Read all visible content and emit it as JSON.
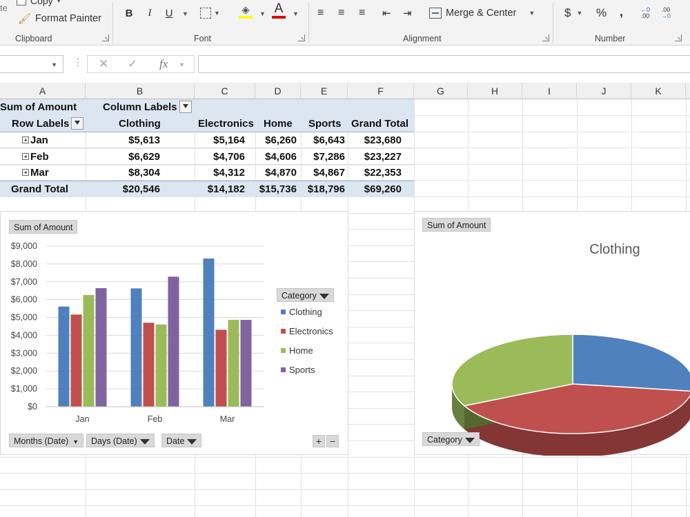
{
  "ribbon": {
    "clipboard": {
      "copy_label": "Copy",
      "format_painter_label": "Format Painter",
      "group_label": "Clipboard",
      "paste_partial": "te"
    },
    "font": {
      "group_label": "Font",
      "bold": "B",
      "italic": "I",
      "underline": "U",
      "font_color_glyph": "A"
    },
    "alignment": {
      "group_label": "Alignment",
      "merge_label": "Merge & Center"
    },
    "number": {
      "group_label": "Number",
      "currency": "$",
      "percent": "%",
      "comma": ",",
      "inc_decimal_top": ".00",
      "dec_decimal_top": ".00"
    }
  },
  "formula_bar": {
    "fx": "fx",
    "value": ""
  },
  "columns": [
    "A",
    "B",
    "C",
    "D",
    "E",
    "F",
    "G",
    "H",
    "I",
    "J",
    "K"
  ],
  "pivot": {
    "title": "Sum of Amount",
    "column_labels": "Column Labels",
    "row_labels": "Row Labels",
    "headers": [
      "Clothing",
      "Electronics",
      "Home",
      "Sports",
      "Grand Total"
    ],
    "rows": [
      {
        "label": "Jan",
        "values": [
          "$5,613",
          "$5,164",
          "$6,260",
          "$6,643",
          "$23,680"
        ]
      },
      {
        "label": "Feb",
        "values": [
          "$6,629",
          "$4,706",
          "$4,606",
          "$7,286",
          "$23,227"
        ]
      },
      {
        "label": "Mar",
        "values": [
          "$8,304",
          "$4,312",
          "$4,870",
          "$4,867",
          "$22,353"
        ]
      }
    ],
    "grand_total": {
      "label": "Grand Total",
      "values": [
        "$20,546",
        "$14,182",
        "$15,736",
        "$18,796",
        "$69,260"
      ]
    }
  },
  "bar_chart": {
    "value_button": "Sum of Amount",
    "legend_title": "Category",
    "axis_buttons": [
      "Months (Date)",
      "Days (Date)",
      "Date"
    ],
    "plus": "+",
    "minus": "−"
  },
  "pie_chart": {
    "value_button": "Sum of Amount",
    "axis_button": "Category"
  },
  "chart_data": [
    {
      "type": "bar",
      "categories": [
        "Jan",
        "Feb",
        "Mar"
      ],
      "series": [
        {
          "name": "Clothing",
          "values": [
            5613,
            6629,
            8304
          ],
          "color": "#4f81bd"
        },
        {
          "name": "Electronics",
          "values": [
            5164,
            4706,
            4312
          ],
          "color": "#c0504d"
        },
        {
          "name": "Home",
          "values": [
            6260,
            4606,
            4870
          ],
          "color": "#9bbb59"
        },
        {
          "name": "Sports",
          "values": [
            6643,
            7286,
            4867
          ],
          "color": "#8064a2"
        }
      ],
      "yticks": [
        "$0",
        "$1,000",
        "$2,000",
        "$3,000",
        "$4,000",
        "$5,000",
        "$6,000",
        "$7,000",
        "$8,000",
        "$9,000"
      ],
      "ylim": [
        0,
        9000
      ],
      "grid": true,
      "legend": "right"
    },
    {
      "type": "pie",
      "title": "Clothing",
      "slices": [
        {
          "value": 5613,
          "color": "#4f81bd"
        },
        {
          "value": 8304,
          "color": "#c0504d"
        },
        {
          "value": 6629,
          "color": "#9bbb59"
        }
      ]
    }
  ]
}
